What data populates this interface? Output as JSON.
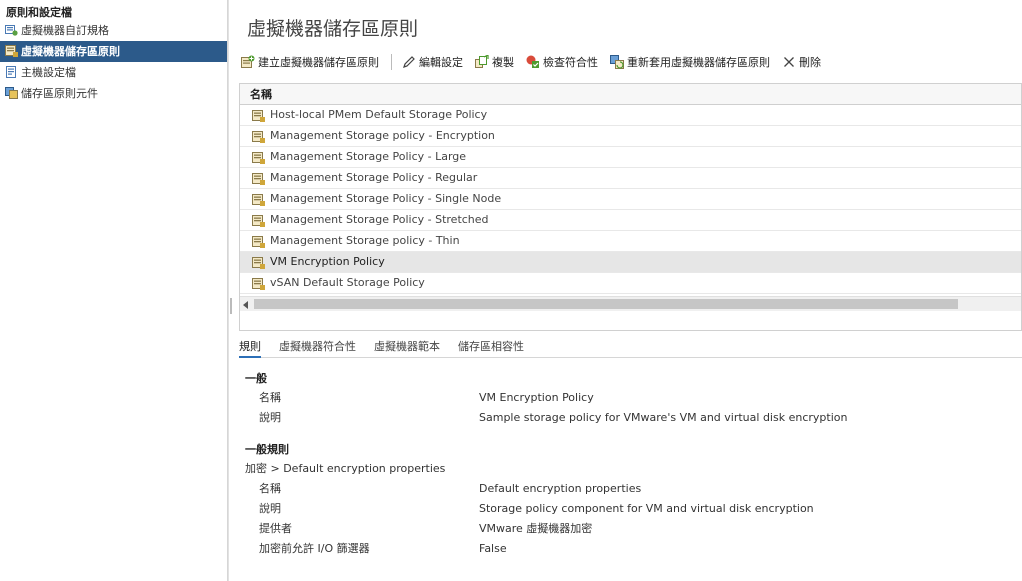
{
  "sidebar": {
    "header": "原則和設定檔",
    "items": [
      {
        "label": "虛擬機器自訂規格",
        "selected": false
      },
      {
        "label": "虛擬機器儲存區原則",
        "selected": true
      },
      {
        "label": "主機設定檔",
        "selected": false
      },
      {
        "label": "儲存區原則元件",
        "selected": false
      }
    ]
  },
  "page": {
    "title": "虛擬機器儲存區原則"
  },
  "toolbar": {
    "create": "建立虛擬機器儲存區原則",
    "edit": "編輯設定",
    "clone": "複製",
    "check": "檢查符合性",
    "reapply": "重新套用虛擬機器儲存區原則",
    "delete": "刪除"
  },
  "grid": {
    "column_name": "名稱",
    "rows": [
      "Host-local PMem Default Storage Policy",
      "Management Storage policy - Encryption",
      "Management Storage Policy - Large",
      "Management Storage Policy - Regular",
      "Management Storage Policy - Single Node",
      "Management Storage Policy - Stretched",
      "Management Storage policy - Thin",
      "VM Encryption Policy",
      "vSAN Default Storage Policy"
    ],
    "selected_row": "VM Encryption Policy"
  },
  "tabs": [
    "規則",
    "虛擬機器符合性",
    "虛擬機器範本",
    "儲存區相容性"
  ],
  "details": {
    "general_title": "一般",
    "general": [
      {
        "key": "名稱",
        "value": "VM Encryption Policy"
      },
      {
        "key": "說明",
        "value": "Sample storage policy for VMware's VM and virtual disk encryption"
      }
    ],
    "rules_title": "一般規則",
    "rules_sub": "加密 > Default encryption properties",
    "rules": [
      {
        "key": "名稱",
        "value": "Default encryption properties"
      },
      {
        "key": "說明",
        "value": "Storage policy component for VM and virtual disk encryption"
      },
      {
        "key": "提供者",
        "value": "VMware 虛擬機器加密"
      },
      {
        "key": "加密前允許 I/O 篩選器",
        "value": "False"
      }
    ]
  },
  "colors": {
    "selection": "#2c5a8a",
    "accent": "#2c6fb7"
  }
}
